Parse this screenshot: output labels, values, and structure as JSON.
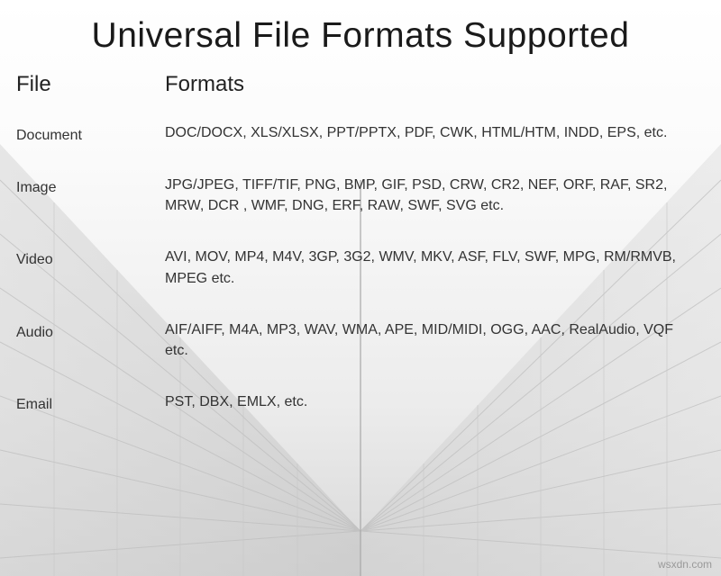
{
  "title": "Universal File Formats Supported",
  "header": {
    "col1": "File",
    "col2": "Formats"
  },
  "rows": [
    {
      "category": "Document",
      "formats": "DOC/DOCX, XLS/XLSX, PPT/PPTX, PDF, CWK, HTML/HTM, INDD, EPS, etc."
    },
    {
      "category": "Image",
      "formats": "JPG/JPEG, TIFF/TIF, PNG, BMP, GIF, PSD, CRW, CR2, NEF, ORF, RAF, SR2, MRW, DCR , WMF, DNG, ERF, RAW, SWF, SVG etc."
    },
    {
      "category": "Video",
      "formats": "AVI, MOV, MP4, M4V, 3GP, 3G2, WMV, MKV, ASF, FLV, SWF, MPG, RM/RMVB, MPEG etc."
    },
    {
      "category": "Audio",
      "formats": "AIF/AIFF, M4A, MP3, WAV, WMA, APE, MID/MIDI, OGG, AAC, RealAudio, VQF etc."
    },
    {
      "category": "Email",
      "formats": "PST, DBX, EMLX, etc."
    }
  ],
  "watermark": "wsxdn.com"
}
